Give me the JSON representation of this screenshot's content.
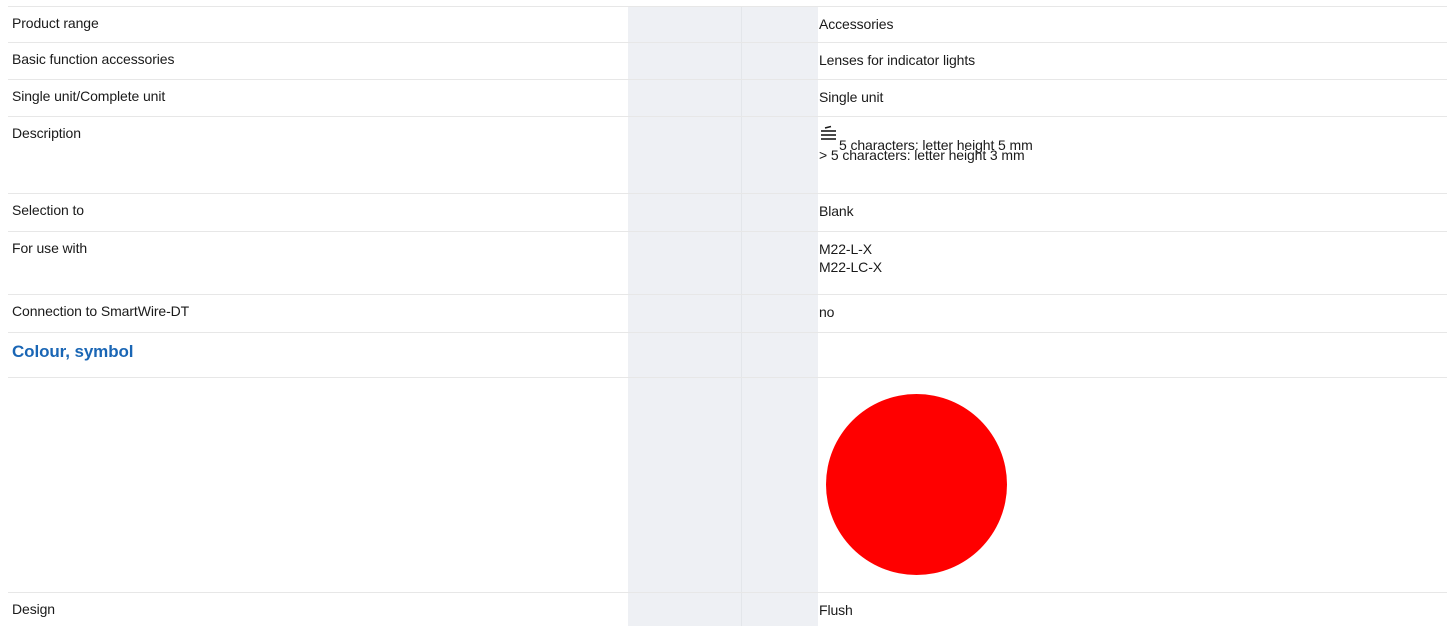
{
  "rows": [
    {
      "label": "Product range",
      "value": "Accessories"
    },
    {
      "label": "Basic function accessories",
      "value": "Lenses for indicator lights"
    },
    {
      "label": "Single unit/Complete unit",
      "value": "Single unit"
    },
    {
      "label": "Description",
      "value_line1": "5 characters: letter height 5 mm",
      "value_line2": "> 5 characters: letter height 3 mm",
      "icon": "stacked-lines-icon"
    },
    {
      "label": "Selection to",
      "value": "Blank"
    },
    {
      "label": "For use with",
      "value_line1": "M22-L-X",
      "value_line2": "M22-LC-X"
    },
    {
      "label": "Connection to SmartWire-DT",
      "value": "no"
    },
    {
      "heading": "Colour, symbol"
    },
    {
      "label": "",
      "swatch_color": "#ff0000"
    },
    {
      "label": "Design",
      "value": "Flush"
    }
  ],
  "colors": {
    "heading": "#1a66b5",
    "band": "#eef0f4",
    "swatch": "#ff0000"
  }
}
